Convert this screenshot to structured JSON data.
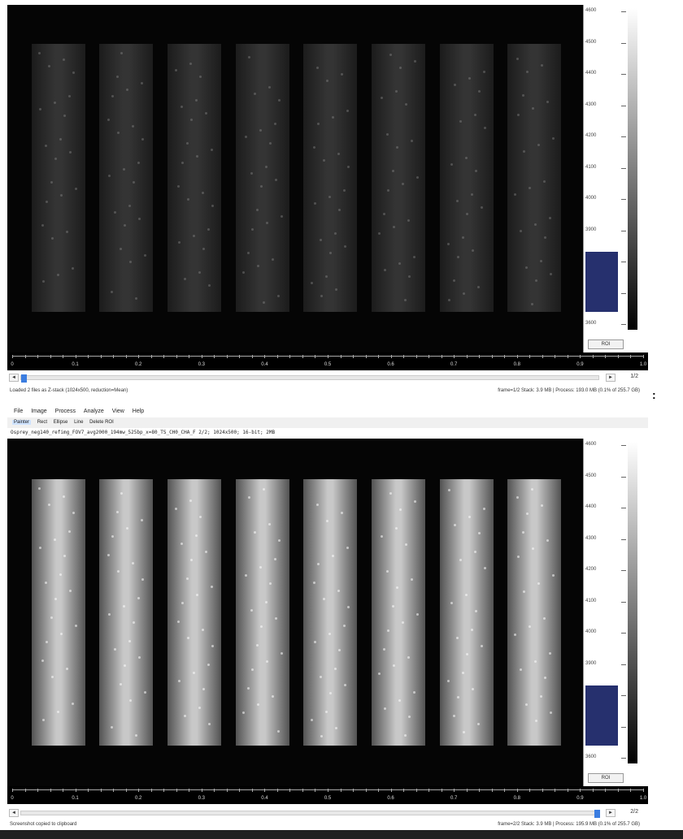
{
  "window1": {
    "title_fragment": "",
    "lut_ticks": [
      "4600",
      "4500",
      "4400",
      "4300",
      "4200",
      "4100",
      "4000",
      "3900",
      "3800",
      "3700",
      "3600"
    ],
    "roi_label": "ROI",
    "axis_ticks": [
      "0",
      "0.1",
      "0.2",
      "0.3",
      "0.4",
      "0.5",
      "0.6",
      "0.7",
      "0.8",
      "0.9",
      "1.0"
    ],
    "scroll_left": "◄",
    "scroll_right": "►",
    "frame_counter": "1/2",
    "status_left": "Loaded 2 files as Z-stack (1024x500, reduction=Mean)",
    "status_right": "frame=1/2  Stack: 3.9 MB | Process: 193.0 MB (0.1% of 255.7 GB)",
    "slider_position": 0.0
  },
  "window2": {
    "menu": [
      "File",
      "Image",
      "Process",
      "Analyze",
      "View",
      "Help"
    ],
    "tools": [
      "Painter",
      "Rect",
      "Ellipse",
      "Line",
      "Delete ROI"
    ],
    "active_tool": "Painter",
    "info": "Osprey_neg140_refimg_FOV7_avg2000_194mw_525bp_x=80_TS_CH0_CHA_F     2/2; 1024x500; 16-bit; 2MB",
    "lut_ticks": [
      "4600",
      "4500",
      "4400",
      "4300",
      "4200",
      "4100",
      "4000",
      "3900",
      "3800",
      "3700",
      "3600"
    ],
    "roi_label": "ROI",
    "axis_ticks": [
      "0",
      "0.1",
      "0.2",
      "0.3",
      "0.4",
      "0.5",
      "0.6",
      "0.7",
      "0.8",
      "0.9",
      "1.0"
    ],
    "scroll_left": "◄",
    "scroll_right": "►",
    "frame_counter": "2/2",
    "status_left": "Screenshot copied to clipboard",
    "status_right": "frame=2/2  Stack: 3.9 MB | Process: 195.9 MB (0.1% of 255.7 GB)",
    "slider_position": 1.0
  },
  "side_menu_glyph": ":",
  "colors": {
    "histogram": "#26306e",
    "slider_thumb": "#3b7de0",
    "background": "#000000"
  }
}
